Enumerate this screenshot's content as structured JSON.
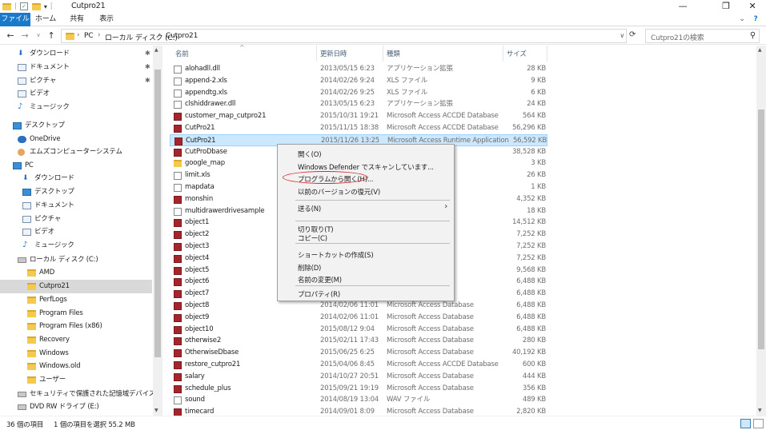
{
  "window": {
    "title": "Cutpro21",
    "controls": {
      "minimize": "—",
      "maximize": "❐",
      "close": "✕"
    }
  },
  "ribbon": {
    "tabs": [
      {
        "label": "ファイル",
        "active": true
      },
      {
        "label": "ホーム"
      },
      {
        "label": "共有"
      },
      {
        "label": "表示"
      }
    ],
    "expand_glyph": "⌄",
    "help_glyph": "?"
  },
  "address": {
    "crumbs": [
      "PC",
      "ローカル ディスク (C:)",
      "Cutpro21"
    ],
    "separator": "›",
    "search_placeholder": "Cutpro21の検索"
  },
  "nav": {
    "items": [
      {
        "label": "ダウンロード",
        "icon": "download-arrow-icon",
        "pinned": true
      },
      {
        "label": "ドキュメント",
        "icon": "document-icon",
        "pinned": true
      },
      {
        "label": "ピクチャ",
        "icon": "picture-icon",
        "pinned": true
      },
      {
        "label": "ビデオ",
        "icon": "video-icon"
      },
      {
        "label": "ミュージック",
        "icon": "music-note-icon"
      },
      {
        "label": "デスクトップ",
        "icon": "desktop-icon"
      },
      {
        "label": "OneDrive",
        "icon": "cloud-icon"
      },
      {
        "label": "エムズコンピューターシステム",
        "icon": "person-icon"
      },
      {
        "label": "PC",
        "icon": "pc-icon"
      },
      {
        "label": "ダウンロード",
        "icon": "download-arrow-icon"
      },
      {
        "label": "デスクトップ",
        "icon": "desktop-icon"
      },
      {
        "label": "ドキュメント",
        "icon": "document-icon"
      },
      {
        "label": "ピクチャ",
        "icon": "picture-icon"
      },
      {
        "label": "ビデオ",
        "icon": "video-icon"
      },
      {
        "label": "ミュージック",
        "icon": "music-note-icon"
      },
      {
        "label": "ローカル ディスク (C:)",
        "icon": "drive-icon"
      },
      {
        "label": "AMD",
        "icon": "folder-icon"
      },
      {
        "label": "Cutpro21",
        "icon": "folder-icon",
        "selected": true
      },
      {
        "label": "PerfLogs",
        "icon": "folder-icon"
      },
      {
        "label": "Program Files",
        "icon": "folder-icon"
      },
      {
        "label": "Program Files (x86)",
        "icon": "folder-icon"
      },
      {
        "label": "Recovery",
        "icon": "folder-icon"
      },
      {
        "label": "Windows",
        "icon": "folder-icon"
      },
      {
        "label": "Windows.old",
        "icon": "folder-icon"
      },
      {
        "label": "ユーザー",
        "icon": "folder-icon"
      },
      {
        "label": "セキュリティで保護された記憶域デバイス (D:)",
        "icon": "secure-drive-icon"
      },
      {
        "label": "DVD RW ドライブ (E:)",
        "icon": "dvd-drive-icon"
      }
    ]
  },
  "columns": {
    "name": "名前",
    "date": "更新日時",
    "type": "種類",
    "size": "サイズ"
  },
  "files": [
    {
      "name": "alohadll.dll",
      "date": "2013/05/15 6:23",
      "type": "アプリケーション拡張",
      "size": "28 KB",
      "icon": "dll"
    },
    {
      "name": "append-2.xls",
      "date": "2014/02/26 9:24",
      "type": "XLS ファイル",
      "size": "9 KB",
      "icon": "file"
    },
    {
      "name": "appendtg.xls",
      "date": "2014/02/26 9:25",
      "type": "XLS ファイル",
      "size": "6 KB",
      "icon": "file"
    },
    {
      "name": "clshiddrawer.dll",
      "date": "2013/05/15 6:23",
      "type": "アプリケーション拡張",
      "size": "24 KB",
      "icon": "dll"
    },
    {
      "name": "customer_map_cutpro21",
      "date": "2015/10/31 19:21",
      "type": "Microsoft Access ACCDE Database",
      "size": "564 KB",
      "icon": "acc"
    },
    {
      "name": "CutPro21",
      "date": "2015/11/15 18:38",
      "type": "Microsoft Access ACCDE Database",
      "size": "56,296 KB",
      "icon": "acc"
    },
    {
      "name": "CutPro21",
      "date": "2015/11/26 13:25",
      "type": "Microsoft Access Runtime Application",
      "size": "56,592 KB",
      "icon": "acc",
      "selected": true
    },
    {
      "name": "CutProDbase",
      "date": "",
      "type": "",
      "size": "38,528 KB",
      "icon": "acc"
    },
    {
      "name": "google_map",
      "date": "",
      "type": "",
      "size": "3 KB",
      "icon": "folder"
    },
    {
      "name": "limit.xls",
      "date": "",
      "type": "",
      "size": "26 KB",
      "icon": "file"
    },
    {
      "name": "mapdata",
      "date": "",
      "type": "",
      "size": "1 KB",
      "icon": "file"
    },
    {
      "name": "monshin",
      "date": "",
      "type": "",
      "size": "4,352 KB",
      "icon": "acc"
    },
    {
      "name": "multidrawerdrivesample",
      "date": "",
      "type": "",
      "size": "18 KB",
      "icon": "file"
    },
    {
      "name": "object1",
      "date": "",
      "type": "ase",
      "size": "14,512 KB",
      "icon": "acc"
    },
    {
      "name": "object2",
      "date": "",
      "type": "ase",
      "size": "7,252 KB",
      "icon": "acc"
    },
    {
      "name": "object3",
      "date": "",
      "type": "ase",
      "size": "7,252 KB",
      "icon": "acc"
    },
    {
      "name": "object4",
      "date": "",
      "type": "ase",
      "size": "7,252 KB",
      "icon": "acc"
    },
    {
      "name": "object5",
      "date": "",
      "type": "ase",
      "size": "9,568 KB",
      "icon": "acc"
    },
    {
      "name": "object6",
      "date": "",
      "type": "ase",
      "size": "6,488 KB",
      "icon": "acc"
    },
    {
      "name": "object7",
      "date": "",
      "type": "ase",
      "size": "6,488 KB",
      "icon": "acc"
    },
    {
      "name": "object8",
      "date": "2014/02/06 11:01",
      "type": "Microsoft Access Database",
      "size": "6,488 KB",
      "icon": "acc"
    },
    {
      "name": "object9",
      "date": "2014/02/06 11:01",
      "type": "Microsoft Access Database",
      "size": "6,488 KB",
      "icon": "acc"
    },
    {
      "name": "object10",
      "date": "2015/08/12 9:04",
      "type": "Microsoft Access Database",
      "size": "6,488 KB",
      "icon": "acc"
    },
    {
      "name": "otherwise2",
      "date": "2015/02/11 17:43",
      "type": "Microsoft Access Database",
      "size": "280 KB",
      "icon": "acc"
    },
    {
      "name": "OtherwiseDbase",
      "date": "2015/06/25 6:25",
      "type": "Microsoft Access Database",
      "size": "40,192 KB",
      "icon": "acc"
    },
    {
      "name": "restore_cutpro21",
      "date": "2015/04/06 8:45",
      "type": "Microsoft Access ACCDE Database",
      "size": "600 KB",
      "icon": "acc"
    },
    {
      "name": "salary",
      "date": "2014/10/27 20:51",
      "type": "Microsoft Access Database",
      "size": "444 KB",
      "icon": "acc"
    },
    {
      "name": "schedule_plus",
      "date": "2015/09/21 19:19",
      "type": "Microsoft Access Database",
      "size": "356 KB",
      "icon": "acc"
    },
    {
      "name": "sound",
      "date": "2014/08/19 13:04",
      "type": "WAV ファイル",
      "size": "489 KB",
      "icon": "file"
    },
    {
      "name": "timecard",
      "date": "2014/09/01 8:09",
      "type": "Microsoft Access Database",
      "size": "2,820 KB",
      "icon": "acc"
    }
  ],
  "context_menu": {
    "items": [
      {
        "label": "開く(O)",
        "bold": true
      },
      {
        "label": "Windows Defender でスキャンしています..."
      },
      {
        "label": "プログラムから開く(H)...",
        "circled": true
      },
      {
        "label": "以前のバージョンの復元(V)"
      },
      {
        "sep": true
      },
      {
        "label": "送る(N)",
        "submenu": true
      },
      {
        "sep": true
      },
      {
        "label": "切り取り(T)"
      },
      {
        "label": "コピー(C)"
      },
      {
        "sep": true
      },
      {
        "label": "ショートカットの作成(S)"
      },
      {
        "label": "削除(D)"
      },
      {
        "label": "名前の変更(M)"
      },
      {
        "sep": true
      },
      {
        "label": "プロパティ(R)"
      }
    ],
    "highlight_color": "#d9272e"
  },
  "status": {
    "count": "36 個の項目",
    "selection": "1 個の項目を選択  55.2 MB"
  },
  "colors": {
    "ribbon_file_tab": "#1979ca",
    "selection": "#cce8ff",
    "nav_selected": "#d9d9d9"
  }
}
